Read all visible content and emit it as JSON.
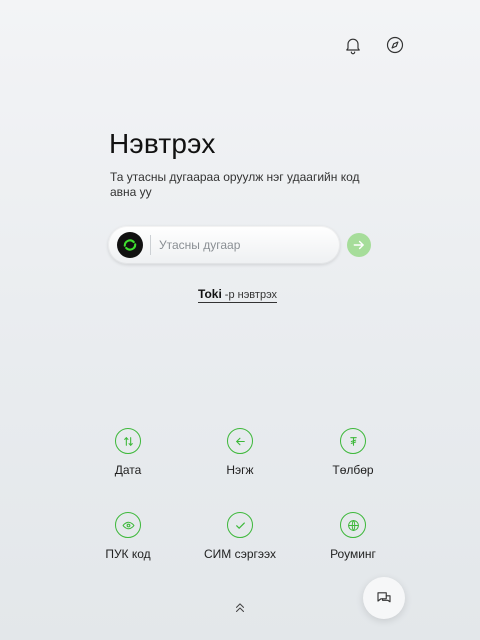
{
  "header": {
    "notification_icon": "bell-icon",
    "explore_icon": "compass-icon"
  },
  "login": {
    "title": "Нэвтрэх",
    "subtitle": "Та утасны дугаараа оруулж нэг удаагийн код авна уу",
    "phone_placeholder": "Утасны дугаар",
    "phone_value": "",
    "submit_icon": "arrow-right-icon"
  },
  "toki": {
    "brand": "Toki",
    "suffix": "-р нэвтрэх"
  },
  "actions": [
    {
      "label": "Дата",
      "icon": "data-transfer-icon"
    },
    {
      "label": "Нэгж",
      "icon": "back-arrow-icon"
    },
    {
      "label": "Төлбөр",
      "icon": "tugrik-icon"
    },
    {
      "label": "ПУК код",
      "icon": "eye-icon"
    },
    {
      "label": "СИМ сэргээх",
      "icon": "check-icon"
    },
    {
      "label": "Роуминг",
      "icon": "globe-icon"
    }
  ],
  "colors": {
    "accent": "#3db83a",
    "submit_bg": "#a6dd9a"
  }
}
